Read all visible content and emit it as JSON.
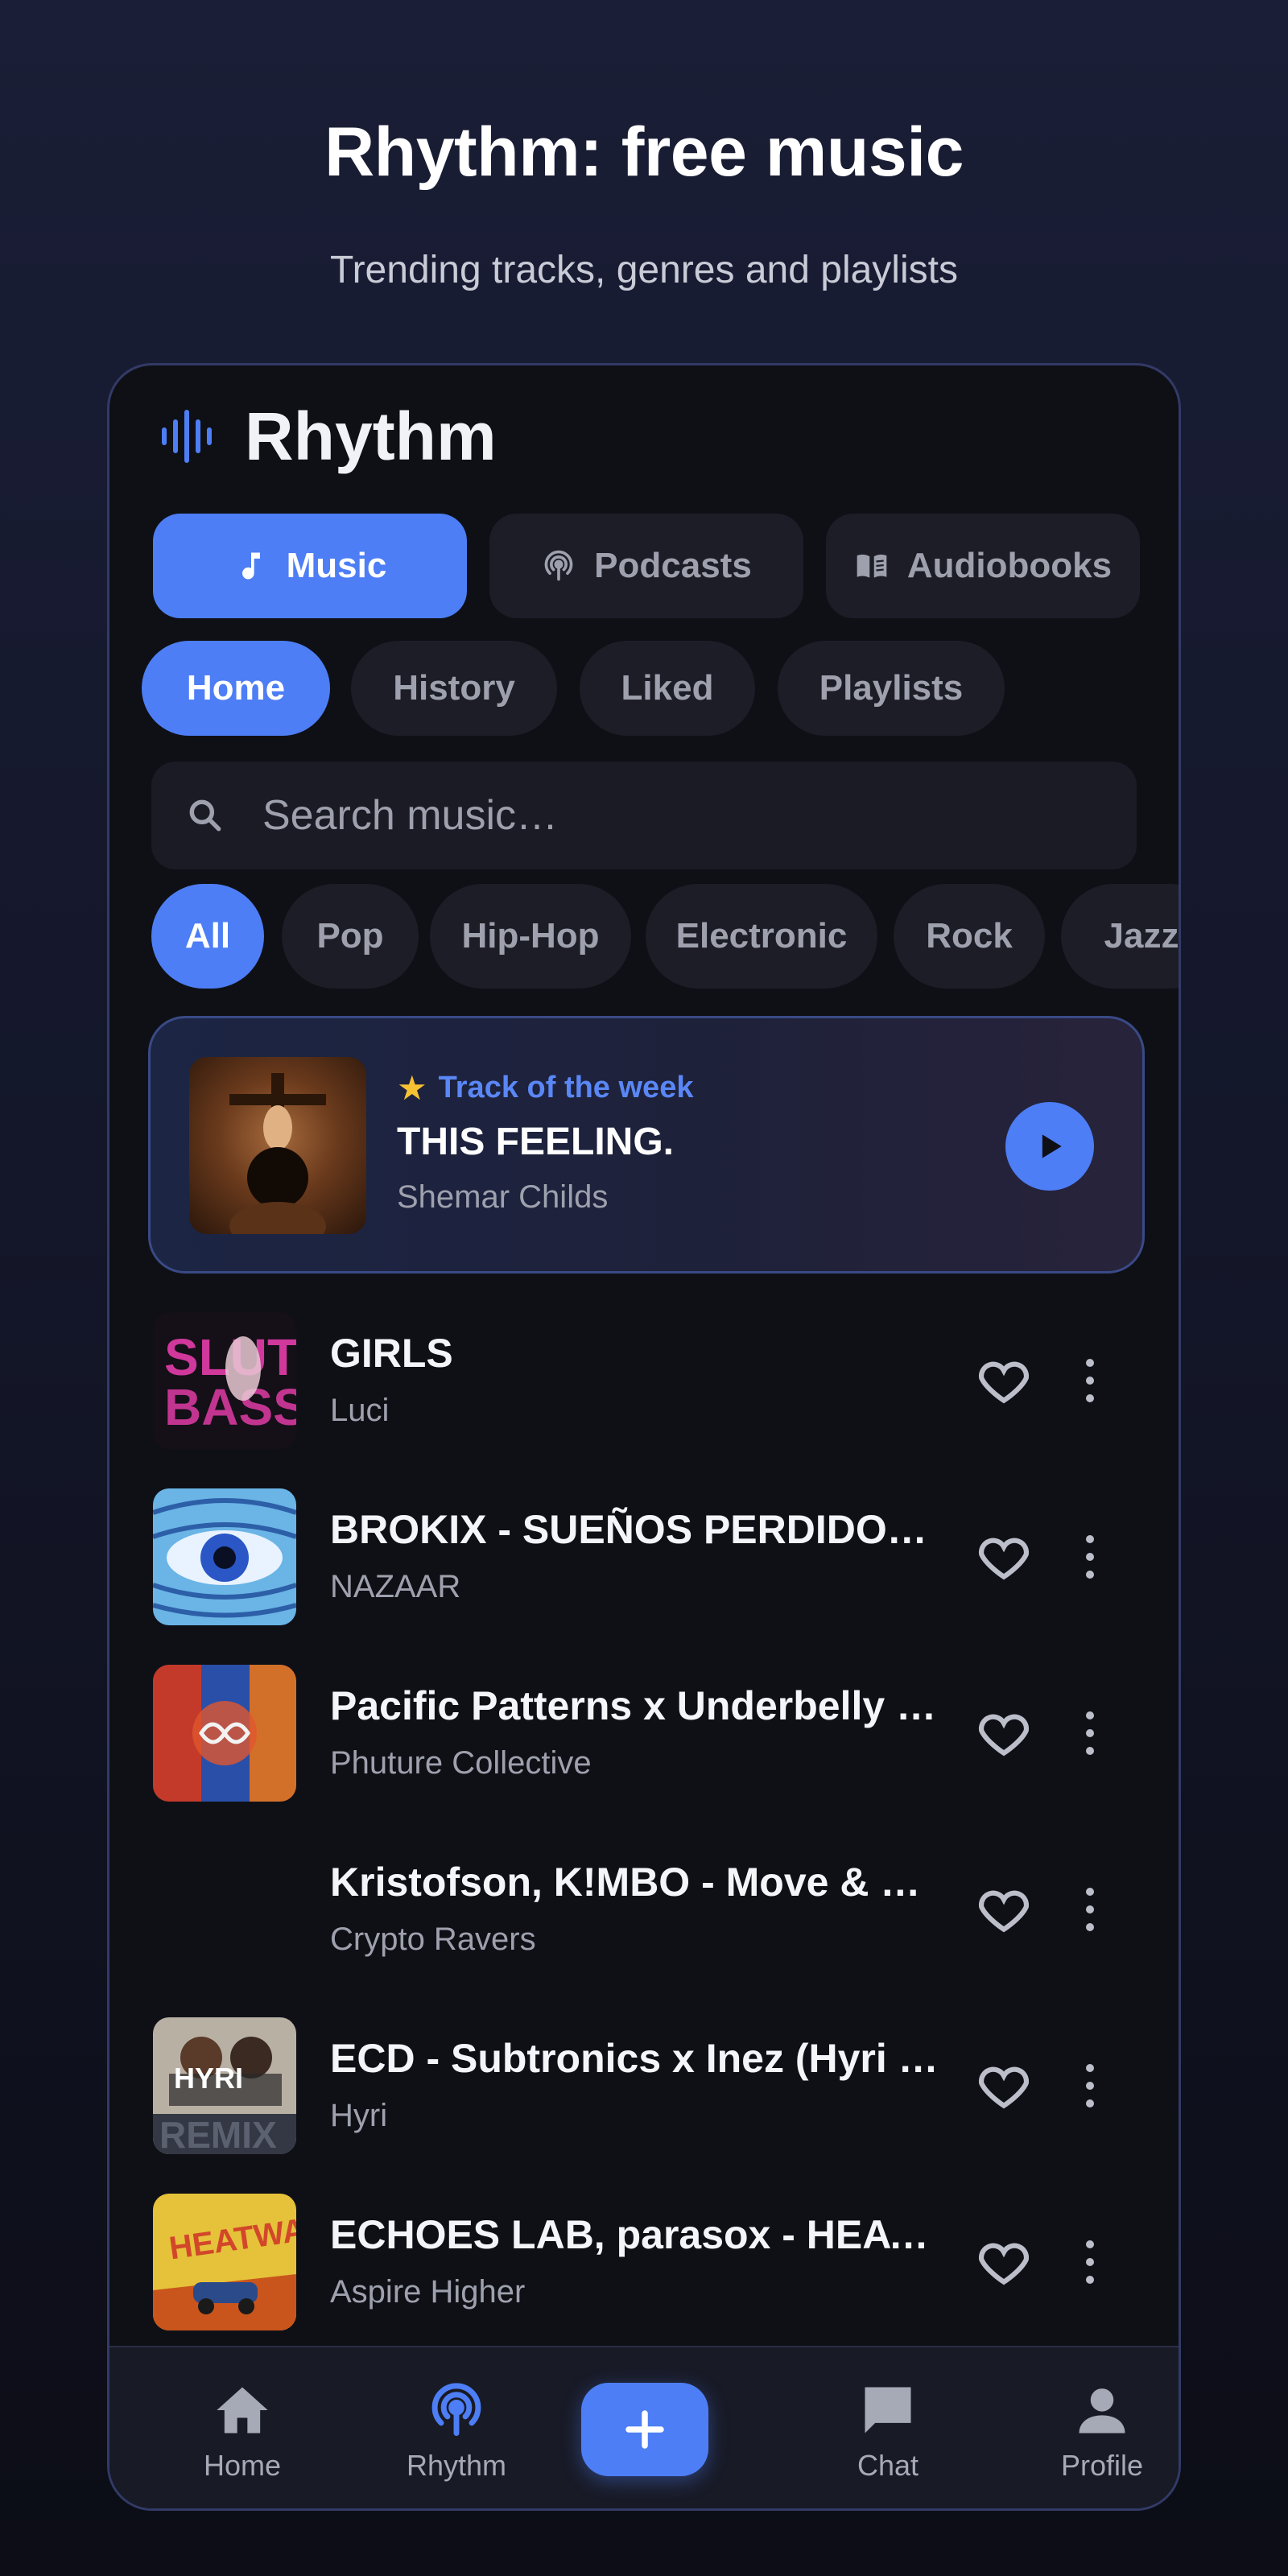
{
  "hero": {
    "title": "Rhythm: free music",
    "subtitle": "Trending tracks, genres and playlists"
  },
  "app": {
    "name": "Rhythm",
    "accent": "#4d7ef5"
  },
  "segments": [
    {
      "label": "Music",
      "icon": "music-note-icon",
      "active": true
    },
    {
      "label": "Podcasts",
      "icon": "podcast-icon",
      "active": false
    },
    {
      "label": "Audiobooks",
      "icon": "book-icon",
      "active": false
    }
  ],
  "tabs": [
    {
      "label": "Home",
      "active": true
    },
    {
      "label": "History",
      "active": false
    },
    {
      "label": "Liked",
      "active": false
    },
    {
      "label": "Playlists",
      "active": false
    }
  ],
  "search": {
    "placeholder": "Search music…",
    "value": ""
  },
  "genres": [
    {
      "label": "All",
      "active": true
    },
    {
      "label": "Pop",
      "active": false
    },
    {
      "label": "Hip-Hop",
      "active": false
    },
    {
      "label": "Electronic",
      "active": false
    },
    {
      "label": "Rock",
      "active": false
    },
    {
      "label": "Jazz",
      "active": false
    }
  ],
  "featured": {
    "label": "Track of the week",
    "title": "THIS FEELING.",
    "artist": "Shemar Childs"
  },
  "tracks": [
    {
      "title": "GIRLS",
      "artist": "Luci"
    },
    {
      "title": "BROKIX - SUEÑOS PERDIDOS (...",
      "artist": "NAZAAR"
    },
    {
      "title": "Pacific Patterns x Underbelly - ...",
      "artist": "Phuture Collective"
    },
    {
      "title": "Kristofson, K!MBO - Move & D...",
      "artist": "Crypto Ravers"
    },
    {
      "title": "ECD - Subtronics x Inez (Hyri R...",
      "artist": "Hyri"
    },
    {
      "title": "ECHOES LAB, parasox - HEAT...",
      "artist": "Aspire Higher"
    }
  ],
  "nav": [
    {
      "label": "Home",
      "icon": "home-icon",
      "active": false
    },
    {
      "label": "Rhythm",
      "icon": "podcast-icon",
      "active": true
    },
    {
      "label": "Chat",
      "icon": "chat-icon",
      "active": false
    },
    {
      "label": "Profile",
      "icon": "profile-icon",
      "active": false
    }
  ]
}
